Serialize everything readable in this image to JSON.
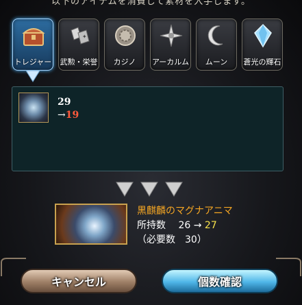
{
  "header": {
    "text": "以下のアイテムを消費して素材を入手します。"
  },
  "tabs": [
    {
      "label": "トレジャー",
      "icon": "treasure-chest-icon",
      "active": true
    },
    {
      "label": "武勲・栄誉",
      "icon": "medals-icon",
      "active": false
    },
    {
      "label": "カジノ",
      "icon": "casino-chip-icon",
      "active": false
    },
    {
      "label": "アーカルム",
      "icon": "arcarum-star-icon",
      "active": false
    },
    {
      "label": "ムーン",
      "icon": "moon-icon",
      "active": false
    },
    {
      "label": "蒼光の輝石",
      "icon": "crystal-icon",
      "active": false
    }
  ],
  "consume_item": {
    "current": "29",
    "arrow": "→",
    "after": "19"
  },
  "material": {
    "name": "黒麒麟のマグナアニマ",
    "owned_label": "所持数",
    "owned_before": "26",
    "owned_arrow": "→",
    "owned_after": "27",
    "required_text": "（必要数　30）"
  },
  "buttons": {
    "cancel": "キャンセル",
    "confirm": "個数確認"
  },
  "colors": {
    "active_tab": "#2d6ca0",
    "after_value": "#ff5a3c",
    "material_name": "#f5a623",
    "owned_after": "#f7e14b"
  }
}
